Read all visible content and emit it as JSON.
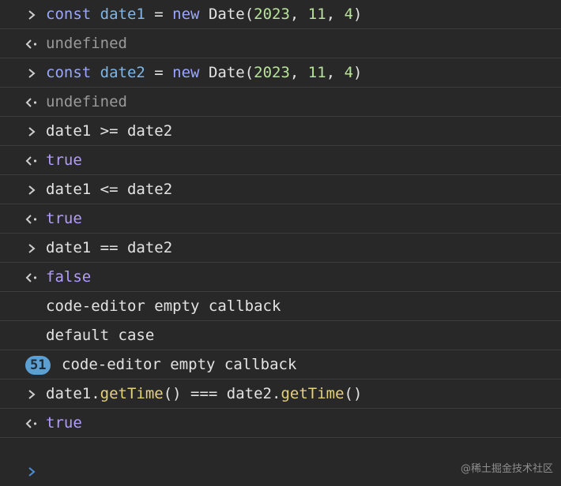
{
  "console": {
    "rows": [
      {
        "kind": "input",
        "parts": [
          {
            "t": "const ",
            "c": "kw"
          },
          {
            "t": "date1",
            "c": "var"
          },
          {
            "t": " = "
          },
          {
            "t": "new ",
            "c": "kw"
          },
          {
            "t": "Date("
          },
          {
            "t": "2023",
            "c": "num"
          },
          {
            "t": ", "
          },
          {
            "t": "11",
            "c": "num"
          },
          {
            "t": ", "
          },
          {
            "t": "4",
            "c": "num"
          },
          {
            "t": ")"
          }
        ]
      },
      {
        "kind": "output",
        "parts": [
          {
            "t": "undefined",
            "c": "muted"
          }
        ]
      },
      {
        "kind": "input",
        "parts": [
          {
            "t": "const ",
            "c": "kw"
          },
          {
            "t": "date2",
            "c": "var"
          },
          {
            "t": " = "
          },
          {
            "t": "new ",
            "c": "kw"
          },
          {
            "t": "Date("
          },
          {
            "t": "2023",
            "c": "num"
          },
          {
            "t": ", "
          },
          {
            "t": "11",
            "c": "num"
          },
          {
            "t": ", "
          },
          {
            "t": "4",
            "c": "num"
          },
          {
            "t": ")"
          }
        ]
      },
      {
        "kind": "output",
        "parts": [
          {
            "t": "undefined",
            "c": "muted"
          }
        ]
      },
      {
        "kind": "input",
        "parts": [
          {
            "t": "date1 >= date2"
          }
        ]
      },
      {
        "kind": "output",
        "parts": [
          {
            "t": "true",
            "c": "bool"
          }
        ]
      },
      {
        "kind": "input",
        "parts": [
          {
            "t": "date1 <= date2"
          }
        ]
      },
      {
        "kind": "output",
        "parts": [
          {
            "t": "true",
            "c": "bool"
          }
        ]
      },
      {
        "kind": "input",
        "parts": [
          {
            "t": "date1 == date2"
          }
        ]
      },
      {
        "kind": "output",
        "parts": [
          {
            "t": "false",
            "c": "bool"
          }
        ]
      },
      {
        "kind": "log",
        "parts": [
          {
            "t": "code-editor empty callback"
          }
        ]
      },
      {
        "kind": "log",
        "parts": [
          {
            "t": "default case"
          }
        ]
      },
      {
        "kind": "log",
        "badge": "51",
        "parts": [
          {
            "t": "code-editor empty callback"
          }
        ]
      },
      {
        "kind": "input",
        "parts": [
          {
            "t": "date1."
          },
          {
            "t": "getTime",
            "c": "fn"
          },
          {
            "t": "() === date2."
          },
          {
            "t": "getTime",
            "c": "fn"
          },
          {
            "t": "()"
          }
        ]
      },
      {
        "kind": "output",
        "parts": [
          {
            "t": "true",
            "c": "bool"
          }
        ]
      }
    ]
  },
  "watermark": "@稀土掘金技术社区",
  "colors": {
    "background": "#282828",
    "keyword": "#9aa7ff",
    "variable": "#7fb6e6",
    "number": "#b8e39a",
    "function": "#e6d27a",
    "boolean": "#b39cff",
    "badge": "#5b9fd3"
  },
  "icons": {
    "input": "chevron-right-icon",
    "output": "return-arrow-icon",
    "prompt": "prompt-chevron-icon"
  }
}
